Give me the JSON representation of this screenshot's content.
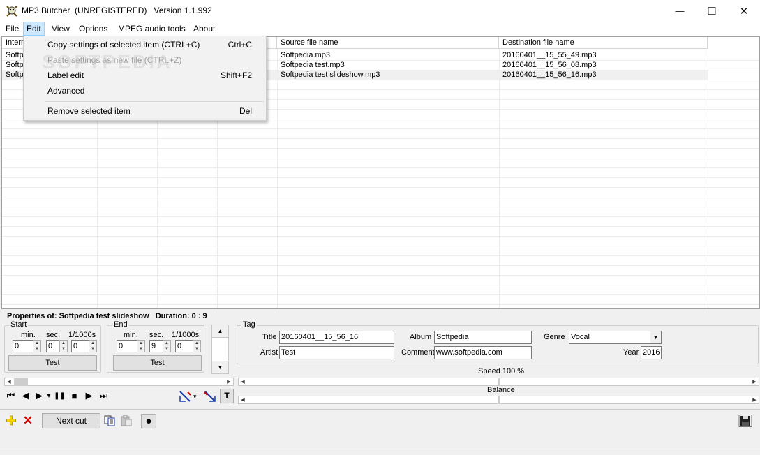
{
  "window": {
    "title": "MP3 Butcher  (UNREGISTERED)   Version 1.1.992",
    "minimize_icon": "minimize-icon",
    "maximize_icon": "maximize-icon",
    "close_icon": "close-icon",
    "min_glyph": "—",
    "max_glyph": "☐",
    "close_glyph": "✕"
  },
  "menu": [
    "File",
    "Edit",
    "View",
    "Options",
    "MPEG audio tools",
    "About"
  ],
  "edit_menu": {
    "items": [
      {
        "label": "Copy settings of selected item (CTRL+C)",
        "shortcut": "Ctrl+C",
        "enabled": true
      },
      {
        "label": "Paste settings as new file (CTRL+Z)",
        "shortcut": "",
        "enabled": false
      },
      {
        "label": "Label edit",
        "shortcut": "Shift+F2",
        "enabled": true
      },
      {
        "label": "Advanced",
        "shortcut": "",
        "enabled": true
      },
      {
        "label": "Remove selected item",
        "shortcut": "Del",
        "enabled": true
      }
    ]
  },
  "watermark": "SOFTPEDIA",
  "list": {
    "columns": [
      "Intern",
      "",
      "",
      "",
      "Source file name",
      "Destination file name"
    ],
    "rows": [
      {
        "c0": "Softp",
        "source": "Softpedia.mp3",
        "dest": "20160401__15_55_49.mp3"
      },
      {
        "c0": "Softp",
        "source": "Softpedia test.mp3",
        "dest": "20160401__15_56_08.mp3"
      },
      {
        "c0": "Softp",
        "source": "Softpedia test slideshow.mp3",
        "dest": "20160401__15_56_16.mp3"
      }
    ],
    "selected_row": 2
  },
  "props": {
    "title": "Properties of: Softpedia test slideshow",
    "duration": "Duration: 0 : 9"
  },
  "start": {
    "label": "Start",
    "min_label": "min.",
    "sec_label": "sec.",
    "ms_label": "1/1000s",
    "min": "0",
    "sec": "0",
    "ms": "0",
    "test": "Test"
  },
  "end": {
    "label": "End",
    "min_label": "min.",
    "sec_label": "sec.",
    "ms_label": "1/1000s",
    "min": "0",
    "sec": "9",
    "ms": "0",
    "test": "Test"
  },
  "tag": {
    "label": "Tag",
    "title_label": "Title",
    "title": "20160401__15_56_16",
    "artist_label": "Artist",
    "artist": "Test",
    "album_label": "Album",
    "album": "Softpedia",
    "comment_label": "Comment",
    "comment": "www.softpedia.com",
    "genre_label": "Genre",
    "genre": "Vocal",
    "year_label": "Year",
    "year": "2016"
  },
  "speed": {
    "label": "Speed 100 %",
    "value_percent": 50
  },
  "balance": {
    "label": "Balance",
    "value_percent": 50
  },
  "transport": {
    "icons": [
      "rewind-start-icon",
      "step-back-icon",
      "play-icon",
      "play-options-icon",
      "pause-icon",
      "stop-icon",
      "step-forward-icon",
      "fast-forward-icon"
    ],
    "glyphs": [
      "⏮",
      "◀",
      "▶",
      "▾",
      "❚❚",
      "■",
      "▶",
      "⏭"
    ]
  },
  "tools": {
    "markers": [
      "set-start-marker-icon",
      "marker-options-icon",
      "set-end-marker-icon",
      "text-tool-icon"
    ],
    "text_tool": "T"
  },
  "bottom": {
    "add_icon": "add-icon",
    "add_glyph": "✚",
    "remove_icon": "remove-icon",
    "remove_glyph": "✕",
    "next_cut": "Next cut",
    "copy_icon": "copy-icon",
    "paste_icon": "paste-icon",
    "record_icon": "record-icon",
    "record_glyph": "●",
    "save_icon": "save-icon"
  },
  "colors": {
    "accent": "#cce8ff",
    "add": "#f5d300",
    "remove": "#d00000"
  }
}
